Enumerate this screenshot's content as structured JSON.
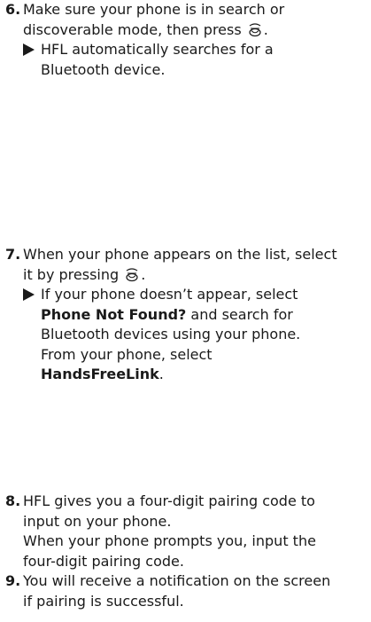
{
  "steps": [
    {
      "num": "6.",
      "text1": "Make sure your phone is in search or",
      "text2a": "discoverable mode, then press ",
      "text2b": ".",
      "note1": "HFL automatically searches for a",
      "note2": "Bluetooth device."
    },
    {
      "num": "7.",
      "text1": "When your phone appears on the list, select",
      "text2a": "it by pressing ",
      "text2b": ".",
      "note1": "If your phone doesn’t appear, select",
      "note2_bold": "Phone Not Found?",
      "note2_rest": " and search for",
      "note3": "Bluetooth devices using your phone.",
      "note4": "From your phone, select",
      "note5_bold": "HandsFreeLink",
      "note5_rest": "."
    },
    {
      "num": "8.",
      "text1": "HFL gives you a four-digit pairing code to",
      "text2": "input on your phone.",
      "text3": "When your phone prompts you, input the",
      "text4": "four-digit pairing code."
    },
    {
      "num": "9.",
      "text1": "You will receive a notification on the screen",
      "text2": "if pairing is successful."
    }
  ],
  "icons": {
    "dial": "selector-knob-icon"
  }
}
